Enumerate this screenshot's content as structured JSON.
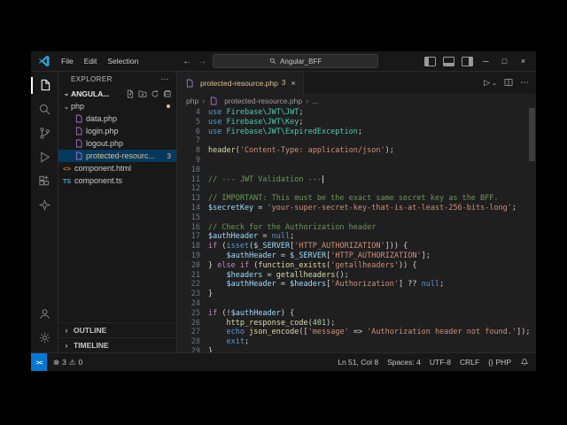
{
  "title_bar": {
    "menus": [
      "File",
      "Edit",
      "Selection"
    ],
    "search_value": "Angular_BFF"
  },
  "sidebar": {
    "header": "EXPLORER",
    "workspace": "ANGULA...",
    "tree": [
      {
        "label": "php",
        "type": "folder",
        "indent": 0,
        "dot": true
      },
      {
        "label": "data.php",
        "type": "php",
        "indent": 1
      },
      {
        "label": "login.php",
        "type": "php",
        "indent": 1
      },
      {
        "label": "logout.php",
        "type": "php",
        "indent": 1
      },
      {
        "label": "protected-resourc...",
        "type": "php",
        "indent": 1,
        "selected": true,
        "modified": true,
        "badge": "3"
      },
      {
        "label": "component.html",
        "type": "html",
        "indent": 0
      },
      {
        "label": "component.ts",
        "type": "ts",
        "indent": 0
      }
    ],
    "sections": [
      "OUTLINE",
      "TIMELINE"
    ]
  },
  "editor": {
    "tab": {
      "label": "protected-resource.php",
      "badge": "3"
    },
    "breadcrumb": [
      "php",
      "protected-resource.php",
      "..."
    ],
    "lines": [
      {
        "n": "4",
        "tk": [
          [
            "k",
            "use "
          ],
          [
            "t",
            "Firebase\\JWT\\JWT"
          ],
          [
            "p",
            ";"
          ]
        ]
      },
      {
        "n": "5",
        "tk": [
          [
            "k",
            "use "
          ],
          [
            "t",
            "Firebase\\JWT\\Key"
          ],
          [
            "p",
            ";"
          ]
        ]
      },
      {
        "n": "6",
        "tk": [
          [
            "k",
            "use "
          ],
          [
            "t",
            "Firebase\\JWT\\ExpiredException"
          ],
          [
            "p",
            ";"
          ]
        ]
      },
      {
        "n": "7",
        "tk": []
      },
      {
        "n": "8",
        "tk": [
          [
            "f",
            "header"
          ],
          [
            "p",
            "("
          ],
          [
            "s",
            "'Content-Type: application/json'"
          ],
          [
            "p",
            ");"
          ]
        ]
      },
      {
        "n": "9",
        "tk": []
      },
      {
        "n": "10",
        "tk": []
      },
      {
        "n": "11",
        "tk": [
          [
            "m",
            "// --- JWT Validation ---"
          ]
        ],
        "cursor": true
      },
      {
        "n": "12",
        "tk": []
      },
      {
        "n": "13",
        "tk": [
          [
            "m",
            "// IMPORTANT: This must be the exact same secret key as the BFF."
          ]
        ]
      },
      {
        "n": "14",
        "tk": [
          [
            "v",
            "$secretKey"
          ],
          [
            "p",
            " = "
          ],
          [
            "s",
            "'your-super-secret-key-that-is-at-least-256-bits-long'"
          ],
          [
            "p",
            ";"
          ]
        ]
      },
      {
        "n": "15",
        "tk": []
      },
      {
        "n": "16",
        "tk": [
          [
            "m",
            "// Check for the Authorization header"
          ]
        ]
      },
      {
        "n": "17",
        "tk": [
          [
            "v",
            "$authHeader"
          ],
          [
            "p",
            " = "
          ],
          [
            "k",
            "null"
          ],
          [
            "p",
            ";"
          ]
        ]
      },
      {
        "n": "18",
        "tk": [
          [
            "c",
            "if"
          ],
          [
            "p",
            " ("
          ],
          [
            "k",
            "isset"
          ],
          [
            "p",
            "("
          ],
          [
            "v",
            "$_SERVER"
          ],
          [
            "p",
            "["
          ],
          [
            "s",
            "'HTTP_AUTHORIZATION'"
          ],
          [
            "p",
            "])) {"
          ]
        ]
      },
      {
        "n": "19",
        "tk": [
          [
            "p",
            "    "
          ],
          [
            "v",
            "$authHeader"
          ],
          [
            "p",
            " = "
          ],
          [
            "v",
            "$_SERVER"
          ],
          [
            "p",
            "["
          ],
          [
            "s",
            "'HTTP_AUTHORIZATION'"
          ],
          [
            "p",
            "];"
          ]
        ]
      },
      {
        "n": "20",
        "tk": [
          [
            "p",
            "} "
          ],
          [
            "c",
            "else"
          ],
          [
            "p",
            " "
          ],
          [
            "c",
            "if"
          ],
          [
            "p",
            " ("
          ],
          [
            "f",
            "function_exists"
          ],
          [
            "p",
            "("
          ],
          [
            "s",
            "'getallheaders'"
          ],
          [
            "p",
            ")) {"
          ]
        ]
      },
      {
        "n": "21",
        "tk": [
          [
            "p",
            "    "
          ],
          [
            "v",
            "$headers"
          ],
          [
            "p",
            " = "
          ],
          [
            "f",
            "getallheaders"
          ],
          [
            "p",
            "();"
          ]
        ]
      },
      {
        "n": "22",
        "tk": [
          [
            "p",
            "    "
          ],
          [
            "v",
            "$authHeader"
          ],
          [
            "p",
            " = "
          ],
          [
            "v",
            "$headers"
          ],
          [
            "p",
            "["
          ],
          [
            "s",
            "'Authorization'"
          ],
          [
            "p",
            "] ?? "
          ],
          [
            "k",
            "null"
          ],
          [
            "p",
            ";"
          ]
        ]
      },
      {
        "n": "23",
        "tk": [
          [
            "p",
            "}"
          ]
        ]
      },
      {
        "n": "24",
        "tk": []
      },
      {
        "n": "25",
        "tk": [
          [
            "c",
            "if"
          ],
          [
            "p",
            " (!"
          ],
          [
            "v",
            "$authHeader"
          ],
          [
            "p",
            ") {"
          ]
        ]
      },
      {
        "n": "26",
        "tk": [
          [
            "p",
            "    "
          ],
          [
            "f",
            "http_response_code"
          ],
          [
            "p",
            "("
          ],
          [
            "num",
            "401"
          ],
          [
            "p",
            ");"
          ]
        ]
      },
      {
        "n": "27",
        "tk": [
          [
            "p",
            "    "
          ],
          [
            "k",
            "echo"
          ],
          [
            "p",
            " "
          ],
          [
            "f",
            "json_encode"
          ],
          [
            "p",
            "(["
          ],
          [
            "s",
            "'message'"
          ],
          [
            "p",
            " => "
          ],
          [
            "s",
            "'Authorization header not found.'"
          ],
          [
            "p",
            "]);"
          ]
        ]
      },
      {
        "n": "28",
        "tk": [
          [
            "p",
            "    "
          ],
          [
            "k",
            "exit"
          ],
          [
            "p",
            ";"
          ]
        ]
      },
      {
        "n": "29",
        "tk": [
          [
            "p",
            "}"
          ]
        ]
      }
    ]
  },
  "status_bar": {
    "errors": "3",
    "warnings": "0",
    "items": [
      "Ln 51, Col 8",
      "Spaces: 4",
      "UTF-8",
      "CRLF",
      "PHP"
    ]
  },
  "colors": {
    "accent": "#0078d4",
    "git_modified": "#e2c08d",
    "selection": "#04395e"
  }
}
